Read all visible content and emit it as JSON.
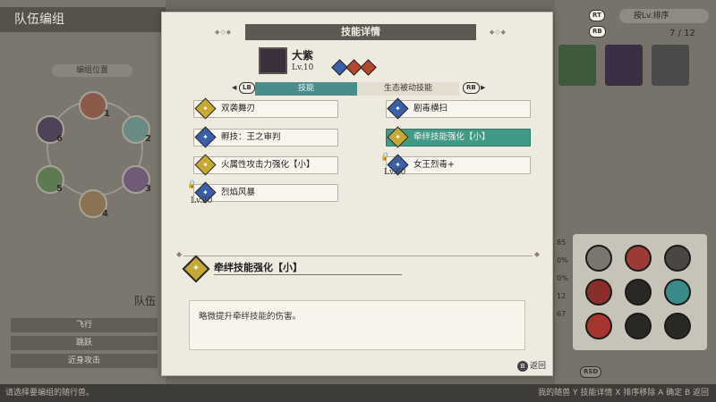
{
  "background": {
    "team_title": "队伍编组",
    "position_label": "编组位置",
    "slot_numbers": [
      "1",
      "2",
      "3",
      "4",
      "5",
      "6"
    ],
    "team_label": "队伍",
    "left_skill_rows": [
      "飞行",
      "跳跃",
      "近身攻击"
    ],
    "sort_button_hint": "RT",
    "sort_label": "按Lv.排序",
    "rb_hint": "RB",
    "page_count": "7 / 12",
    "stat_fragments": [
      "85",
      "0%",
      "0%",
      "12",
      "67"
    ],
    "bottom_left_hint": "请选择要编组的随行兽。",
    "bottom_right_hint": "我的随兽  Y 技能详情  X 排序移除  A 确定  B 返回",
    "rsd_label": "RSD"
  },
  "modal": {
    "title": "技能详情",
    "monster": {
      "name": "大紫",
      "level": "Lv.10",
      "elements": [
        "neutral",
        "fire",
        "fire"
      ]
    },
    "tabs": {
      "lb": "LB",
      "rb": "RB",
      "active": "技能",
      "inactive": "生态被动技能"
    },
    "skills_left": [
      {
        "name": "双袭舞刃",
        "type": "gold",
        "locked": false,
        "lock_level": ""
      },
      {
        "name": "孵技：王之审判",
        "type": "blue",
        "locked": false,
        "lock_level": ""
      },
      {
        "name": "火属性攻击力强化【小】",
        "type": "gold",
        "locked": false,
        "lock_level": ""
      },
      {
        "name": "烈焰风暴",
        "type": "blue",
        "locked": true,
        "lock_level": "Lv.20"
      }
    ],
    "skills_right": [
      {
        "name": "剧毒横扫",
        "type": "blue",
        "locked": false,
        "lock_level": ""
      },
      {
        "name": "牵绊技能强化【小】",
        "type": "gold",
        "locked": false,
        "selected": true,
        "lock_level": ""
      },
      {
        "name": "女王烈毒+",
        "type": "blue",
        "locked": true,
        "lock_level": "Lv.60"
      }
    ],
    "detail": {
      "title": "牵绊技能强化【小】",
      "description": "略微提升牵绊技能的伤害。"
    },
    "back_button": {
      "key": "B",
      "label": "返回"
    }
  },
  "colors": {
    "accent_teal": "#4a8c8c",
    "selected_green": "#3f9a88",
    "gold_icon": "#c6a834",
    "blue_icon": "#3a5fa8"
  }
}
